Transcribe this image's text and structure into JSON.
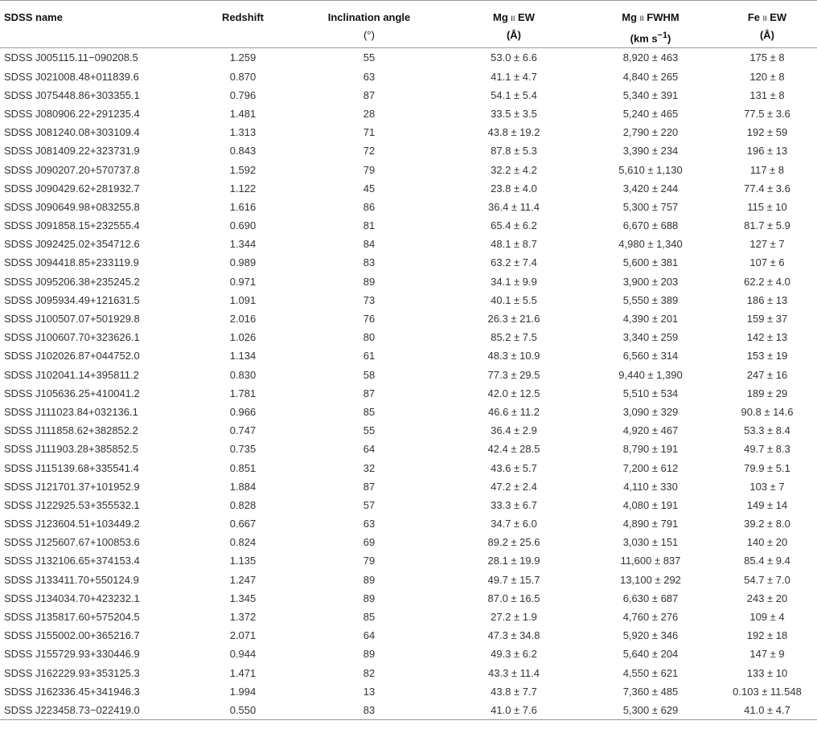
{
  "headers": {
    "name": "SDSS name",
    "redshift": "Redshift",
    "incl": "Inclination angle",
    "incl_unit": "(°)",
    "mg_ew_pre": "Mg ",
    "mg_ew_ion": "ii",
    "mg_ew_post": " EW",
    "mg_ew_unit": "(Å)",
    "mg_fwhm_pre": "Mg ",
    "mg_fwhm_ion": "ii",
    "mg_fwhm_post": " FWHM",
    "mg_fwhm_unit_pre": "(km s",
    "mg_fwhm_unit_sup": "−1",
    "mg_fwhm_unit_post": ")",
    "fe_ew_pre": "Fe ",
    "fe_ew_ion": "ii",
    "fe_ew_post": " EW",
    "fe_ew_unit": "(Å)"
  },
  "rows": [
    [
      "SDSS J005115.11−090208.5",
      "1.259",
      "55",
      "53.0 ± 6.6",
      "8,920 ± 463",
      "175 ± 8"
    ],
    [
      "SDSS J021008.48+011839.6",
      "0.870",
      "63",
      "41.1 ± 4.7",
      "4,840 ± 265",
      "120 ± 8"
    ],
    [
      "SDSS J075448.86+303355.1",
      "0.796",
      "87",
      "54.1 ± 5.4",
      "5,340 ± 391",
      "131 ± 8"
    ],
    [
      "SDSS J080906.22+291235.4",
      "1.481",
      "28",
      "33.5 ± 3.5",
      "5,240 ± 465",
      "77.5 ± 3.6"
    ],
    [
      "SDSS J081240.08+303109.4",
      "1.313",
      "71",
      "43.8 ± 19.2",
      "2,790 ± 220",
      "192 ± 59"
    ],
    [
      "SDSS J081409.22+323731.9",
      "0.843",
      "72",
      "87.8 ± 5.3",
      "3,390 ± 234",
      "196 ± 13"
    ],
    [
      "SDSS J090207.20+570737.8",
      "1.592",
      "79",
      "32.2 ± 4.2",
      "5,610 ± 1,130",
      "117 ± 8"
    ],
    [
      "SDSS J090429.62+281932.7",
      "1.122",
      "45",
      "23.8 ± 4.0",
      "3,420 ± 244",
      "77.4 ± 3.6"
    ],
    [
      "SDSS J090649.98+083255.8",
      "1.616",
      "86",
      "36.4 ± 11.4",
      "5,300 ± 757",
      "115 ± 10"
    ],
    [
      "SDSS J091858.15+232555.4",
      "0.690",
      "81",
      "65.4 ± 6.2",
      "6,670 ± 688",
      "81.7 ± 5.9"
    ],
    [
      "SDSS J092425.02+354712.6",
      "1.344",
      "84",
      "48.1 ± 8.7",
      "4,980 ± 1,340",
      "127 ± 7"
    ],
    [
      "SDSS J094418.85+233119.9",
      "0.989",
      "83",
      "63.2 ± 7.4",
      "5,600 ± 381",
      "107 ± 6"
    ],
    [
      "SDSS J095206.38+235245.2",
      "0.971",
      "89",
      "34.1 ± 9.9",
      "3,900 ± 203",
      "62.2 ± 4.0"
    ],
    [
      "SDSS J095934.49+121631.5",
      "1.091",
      "73",
      "40.1 ± 5.5",
      "5,550 ± 389",
      "186 ± 13"
    ],
    [
      "SDSS J100507.07+501929.8",
      "2.016",
      "76",
      "26.3 ± 21.6",
      "4,390 ± 201",
      "159 ± 37"
    ],
    [
      "SDSS J100607.70+323626.1",
      "1.026",
      "80",
      "85.2 ± 7.5",
      "3,340 ± 259",
      "142 ± 13"
    ],
    [
      "SDSS J102026.87+044752.0",
      "1.134",
      "61",
      "48.3 ± 10.9",
      "6,560 ± 314",
      "153 ± 19"
    ],
    [
      "SDSS J102041.14+395811.2",
      "0.830",
      "58",
      "77.3 ± 29.5",
      "9,440 ± 1,390",
      "247 ± 16"
    ],
    [
      "SDSS J105636.25+410041.2",
      "1.781",
      "87",
      "42.0 ± 12.5",
      "5,510 ± 534",
      "189 ± 29"
    ],
    [
      "SDSS J111023.84+032136.1",
      "0.966",
      "85",
      "46.6 ± 11.2",
      "3,090 ± 329",
      "90.8 ± 14.6"
    ],
    [
      "SDSS J111858.62+382852.2",
      "0.747",
      "55",
      "36.4 ± 2.9",
      "4,920 ± 467",
      "53.3 ± 8.4"
    ],
    [
      "SDSS J111903.28+385852.5",
      "0.735",
      "64",
      "42.4 ± 28.5",
      "8,790 ± 191",
      "49.7 ± 8.3"
    ],
    [
      "SDSS J115139.68+335541.4",
      "0.851",
      "32",
      "43.6 ± 5.7",
      "7,200 ± 612",
      "79.9 ± 5.1"
    ],
    [
      "SDSS J121701.37+101952.9",
      "1.884",
      "87",
      "47.2 ± 2.4",
      "4,110 ± 330",
      "103 ± 7"
    ],
    [
      "SDSS J122925.53+355532.1",
      "0.828",
      "57",
      "33.3 ± 6.7",
      "4,080 ± 191",
      "149 ± 14"
    ],
    [
      "SDSS J123604.51+103449.2",
      "0.667",
      "63",
      "34.7 ± 6.0",
      "4,890 ± 791",
      "39.2 ± 8.0"
    ],
    [
      "SDSS J125607.67+100853.6",
      "0.824",
      "69",
      "89.2 ± 25.6",
      "3,030 ± 151",
      "140 ± 20"
    ],
    [
      "SDSS J132106.65+374153.4",
      "1.135",
      "79",
      "28.1 ± 19.9",
      "11,600 ± 837",
      "85.4 ± 9.4"
    ],
    [
      "SDSS J133411.70+550124.9",
      "1.247",
      "89",
      "49.7 ± 15.7",
      "13,100 ± 292",
      "54.7 ± 7.0"
    ],
    [
      "SDSS J134034.70+423232.1",
      "1.345",
      "89",
      "87.0 ± 16.5",
      "6,630 ± 687",
      "243 ± 20"
    ],
    [
      "SDSS J135817.60+575204.5",
      "1.372",
      "85",
      "27.2 ± 1.9",
      "4,760 ± 276",
      "109 ± 4"
    ],
    [
      "SDSS J155002.00+365216.7",
      "2.071",
      "64",
      "47.3 ± 34.8",
      "5,920 ± 346",
      "192 ± 18"
    ],
    [
      "SDSS J155729.93+330446.9",
      "0.944",
      "89",
      "49.3 ± 6.2",
      "5,640 ± 204",
      "147 ± 9"
    ],
    [
      "SDSS J162229.93+353125.3",
      "1.471",
      "82",
      "43.3 ± 11.4",
      "4,550 ± 621",
      "133 ± 10"
    ],
    [
      "SDSS J162336.45+341946.3",
      "1.994",
      "13",
      "43.8 ± 7.7",
      "7,360 ± 485",
      "0.103 ± 11.548"
    ],
    [
      "SDSS J223458.73−022419.0",
      "0.550",
      "83",
      "41.0 ± 7.6",
      "5,300 ± 629",
      "41.0 ± 4.7"
    ]
  ]
}
